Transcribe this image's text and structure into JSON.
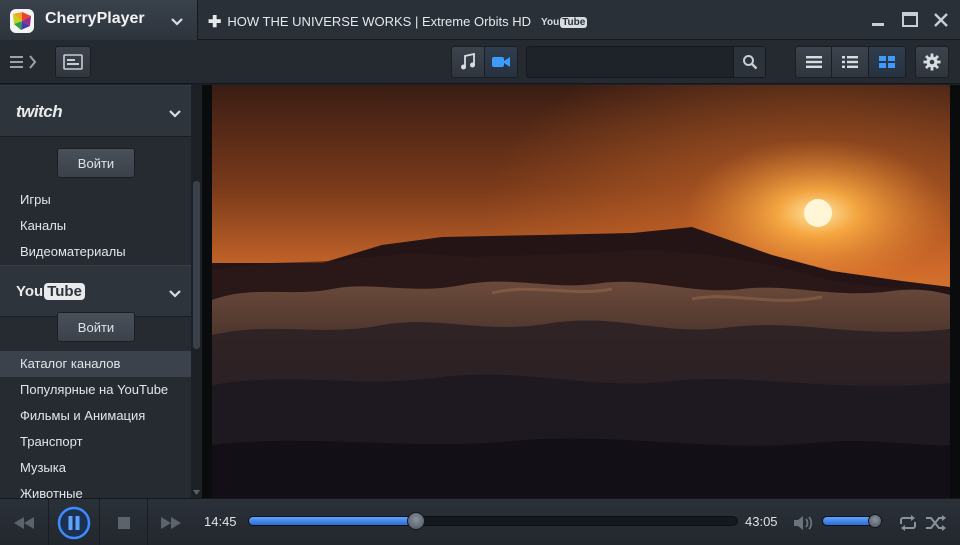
{
  "app": {
    "name": "CherryPlayer"
  },
  "tab": {
    "title": "HOW THE UNIVERSE WORKS | Extreme Orbits HD",
    "source_badge_a": "You",
    "source_badge_b": "Tube"
  },
  "toolbar": {
    "search_placeholder": "",
    "search_value": ""
  },
  "sidebar": {
    "sections": [
      {
        "logo": "twitch",
        "login_label": "Войти",
        "items": [
          "Игры",
          "Каналы",
          "Видеоматериалы"
        ]
      },
      {
        "logo_a": "You",
        "logo_b": "Tube",
        "login_label": "Войти",
        "items": [
          "Каталог каналов",
          "Популярные на YouTube",
          "Фильмы и Анимация",
          "Транспорт",
          "Музыка",
          "Животные"
        ]
      }
    ],
    "selected_item": "Каталог каналов"
  },
  "player": {
    "elapsed": "14:45",
    "duration": "43:05",
    "progress_fraction": 0.3423,
    "volume_fraction": 0.92
  },
  "colors": {
    "accent": "#2c6cd6",
    "accent_light": "#5fa3ff",
    "background": "#1c2127",
    "panel": "#262b32"
  },
  "icons": {
    "logo": "cherryplayer-logo-icon",
    "menu": "hamburger-menu-icon",
    "playlist_add": "playlist-icon",
    "music": "music-note-icon",
    "video": "video-camera-icon",
    "search": "search-icon",
    "list_view": "list-view-icon",
    "detail_view": "detail-list-view-icon",
    "grid_view": "grid-view-icon",
    "settings": "gear-icon"
  }
}
